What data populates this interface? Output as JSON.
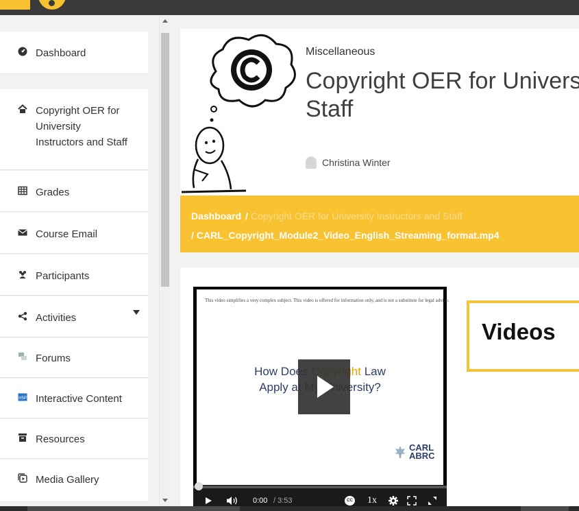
{
  "sidebar": {
    "items": [
      {
        "label": "Dashboard",
        "icon": "dashboard-icon"
      },
      {
        "label": "Copyright OER for University Instructors and Staff",
        "icon": "home-icon"
      },
      {
        "label": "Grades",
        "icon": "table-icon"
      },
      {
        "label": "Course Email",
        "icon": "envelope-icon"
      },
      {
        "label": "Participants",
        "icon": "users-icon"
      },
      {
        "label": "Activities",
        "icon": "share-icon"
      },
      {
        "label": "Forums",
        "icon": "forum-icon"
      },
      {
        "label": "Interactive Content",
        "icon": "h5p-icon"
      },
      {
        "label": "Resources",
        "icon": "archive-icon"
      },
      {
        "label": "Media Gallery",
        "icon": "media-gallery-icon"
      }
    ]
  },
  "course": {
    "category": "Miscellaneous",
    "title_line1": "Copyright OER for Univers",
    "title_line2": "Staff",
    "instructor": "Christina Winter"
  },
  "breadcrumb": {
    "home": "Dashboard",
    "course": "Copyright OER for University Instructors and Staff",
    "separator": "/",
    "file": "CARL_Copyright_Module2_Video_English_Streaming_format.mp4"
  },
  "video": {
    "disclaimer": "This video simplifies a very complex subject. This video is offered for information only, and is not a substitute for legal advice.",
    "slide_title_a": "How Does ",
    "slide_title_hl1": "Copyright",
    "slide_title_b": " Law",
    "slide_title_line2": "Apply at My University?",
    "logo_line1": "CARL",
    "logo_line2": "ABRC",
    "current_time": "0:00",
    "duration": "/ 3:53",
    "speed": "1x",
    "cc_label": "CC",
    "progress": 0
  },
  "content": {
    "section_label": "Videos"
  },
  "colors": {
    "accent": "#f9c231",
    "title": "#2c3d6a"
  }
}
